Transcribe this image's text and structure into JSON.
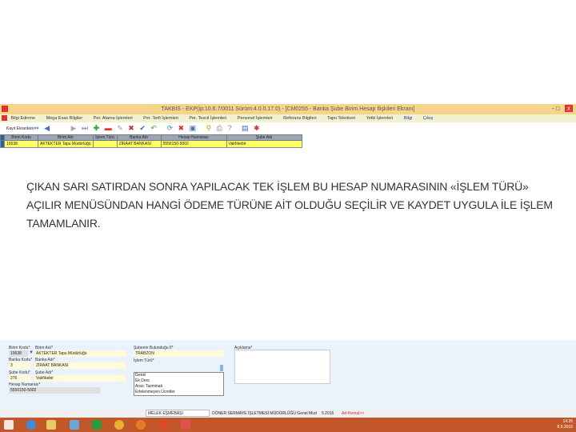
{
  "window": {
    "title": "TAKBIS - EKP(ip:10.6.7/0011 Sürüm:4.0.0.17.0) - [CM0255 - Banka Şube Birim Hesap İlişkileri Ekranı]",
    "controls": [
      "-",
      "□",
      "x"
    ]
  },
  "menu": [
    "Bilgi Edinme",
    "Mega Esas Bilgiler",
    "Per. Atama İşlemleri",
    "Per. Terfi İşlemleri",
    "Per. Tescil İşlemleri",
    "Personel İşlemleri",
    "Referans Bilgileri",
    "Tapu Teknikeri",
    "Yetki İşlemleri",
    "Bilgi",
    "Çıkış"
  ],
  "toolbar": {
    "first_label": "Kayıt Ekranları",
    "icons": [
      "first-icon",
      "prev-icon",
      "next-icon",
      "last-icon",
      "add-icon",
      "remove-icon",
      "edit-icon",
      "delete-icon",
      "save-check-icon",
      "undo-icon",
      "refresh-icon",
      "cancel-icon",
      "disk-icon",
      "search-icon",
      "print-icon",
      "help-icon",
      "export-icon",
      "exit-icon"
    ]
  },
  "grid": {
    "headers": [
      "Birim Kodu",
      "Birim Adı",
      "İşlem Türü",
      "Banka Adı",
      "Hesap Numarası",
      "Şube Adı"
    ],
    "row": [
      "10638",
      "AKTEKTER Tapu Müdürlüğü",
      "",
      "ZİRAAT BANKASI",
      "5556150-5002",
      "Vakfıkebir"
    ]
  },
  "slide": {
    "text": "ÇIKAN SARI SATIRDAN SONRA YAPILACAK TEK İŞLEM BU HESAP NUMARASININ «İŞLEM TÜRÜ» AÇILIR MENÜSÜNDAN HANGİ ÖDEME TÜRÜNE AİT OLDUĞU SEÇİLİR VE KAYDET UYGULA İLE İŞLEM TAMAMLANIR."
  },
  "form": {
    "birim_kodu_label": "Birim Kodu*",
    "birim_kodu": "10638",
    "birim_adi_label": "Birim Adı*",
    "birim_adi": "AKTEKTER Tapu Müdürlüğü",
    "banka_kodu_label": "Banka Kodu*",
    "banka_kodu": "3",
    "banka_adi_label": "Banka Adı*",
    "banka_adi": "ZİRAAT BANKASI",
    "sube_kodu_label": "Şube Kodu*",
    "sube_kodu": "276",
    "sube_adi_label": "Şube Adı*",
    "sube_adi": "Vakfıkebir",
    "hesap_label": "Hesap Numarası*",
    "hesap": "5556150-5002",
    "il_label": "Şubenin Bulunduğu İl*",
    "il": "TRABZON",
    "islem_turu_label": "İşlem Türü*",
    "islem_turu_options": [
      "Genel",
      "Ek Ders",
      "Aracı Tazminatı",
      "Ertelenmeyen Ücretler"
    ],
    "aciklama_label": "Açıklama*"
  },
  "status": {
    "user": "MELEK EŞMEBAŞI",
    "unit": "DÖNER SERMAYE İŞLETMESİ MÜDÜRLÜĞÜ Genel Mud",
    "date": "5.2016",
    "link": "Ad-Hemal>>"
  },
  "clock": {
    "time": "14:26",
    "date": "8.5.2016"
  }
}
